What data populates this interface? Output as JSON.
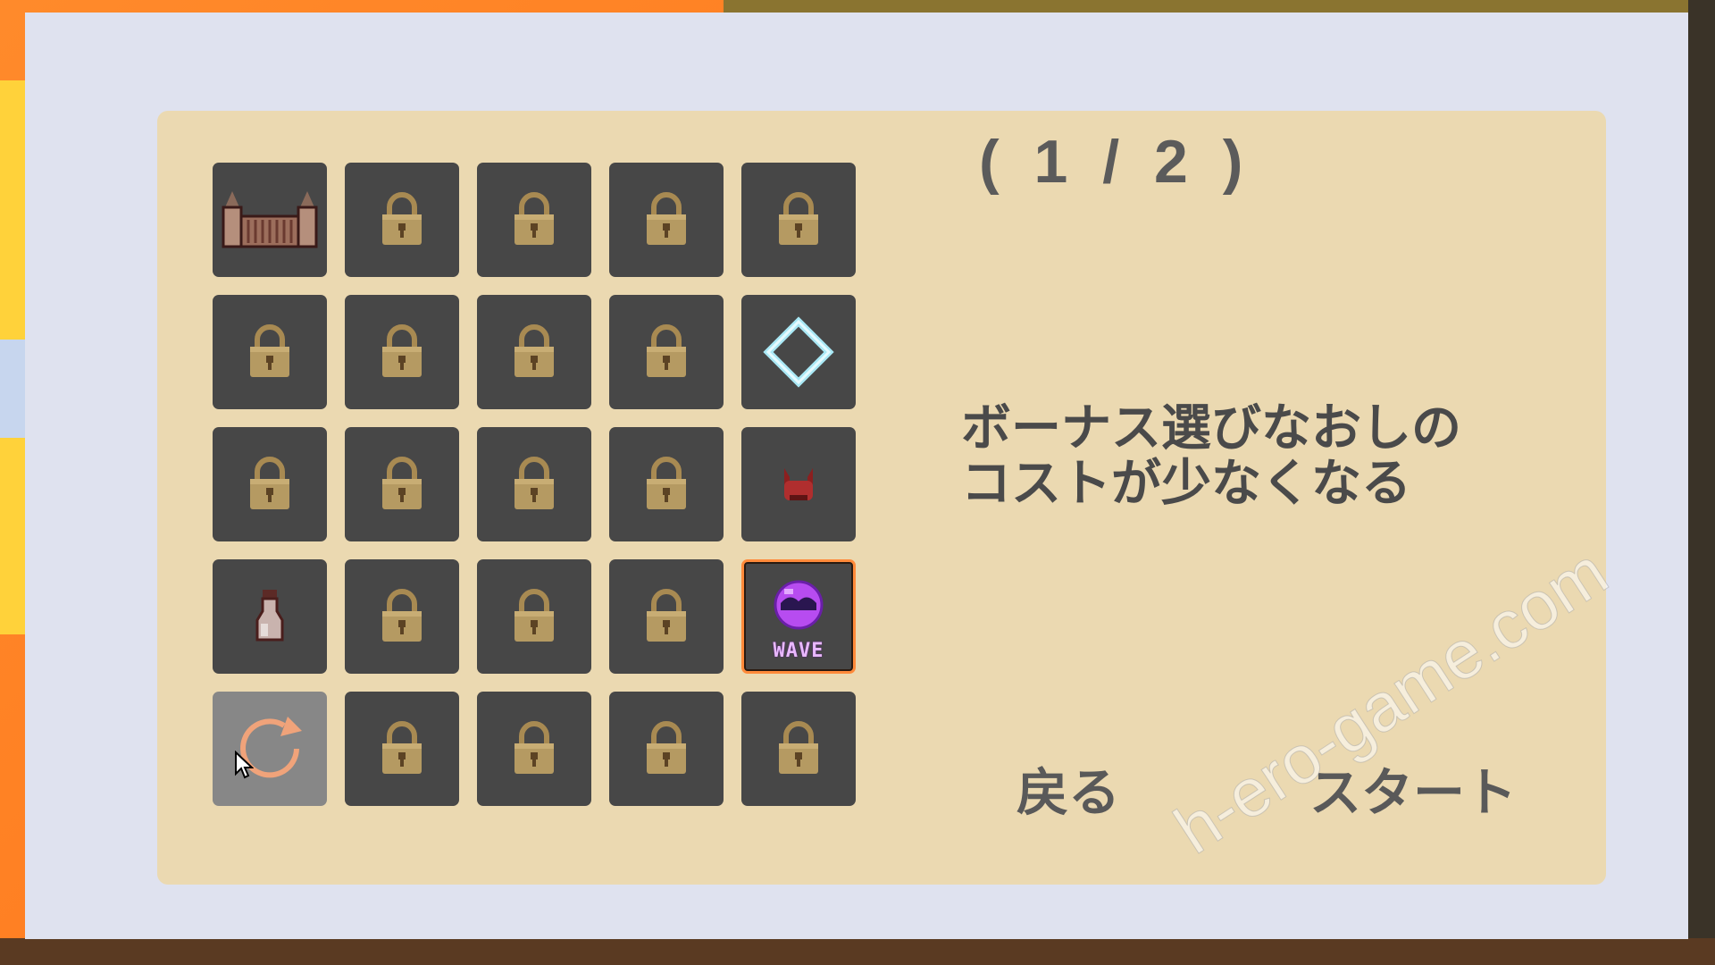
{
  "page_indicator": "( 1 / 2 )",
  "description": "ボーナス選びなおしの\nコストが少なくなる",
  "buttons": {
    "back": "戻る",
    "start": "スタート"
  },
  "slot_rows": [
    [
      {
        "icon": "gate-icon",
        "state": "unlocked"
      },
      {
        "icon": "padlock-icon",
        "state": "locked"
      },
      {
        "icon": "padlock-icon",
        "state": "locked"
      },
      {
        "icon": "padlock-icon",
        "state": "locked"
      },
      {
        "icon": "padlock-icon",
        "state": "locked"
      }
    ],
    [
      {
        "icon": "padlock-icon",
        "state": "locked"
      },
      {
        "icon": "padlock-icon",
        "state": "locked"
      },
      {
        "icon": "padlock-icon",
        "state": "locked"
      },
      {
        "icon": "padlock-icon",
        "state": "locked"
      },
      {
        "icon": "diamond-icon",
        "state": "unlocked"
      }
    ],
    [
      {
        "icon": "padlock-icon",
        "state": "locked"
      },
      {
        "icon": "padlock-icon",
        "state": "locked"
      },
      {
        "icon": "padlock-icon",
        "state": "locked"
      },
      {
        "icon": "padlock-icon",
        "state": "locked"
      },
      {
        "icon": "horned-helmet-icon",
        "state": "unlocked"
      }
    ],
    [
      {
        "icon": "bottle-icon",
        "state": "unlocked"
      },
      {
        "icon": "padlock-icon",
        "state": "locked"
      },
      {
        "icon": "padlock-icon",
        "state": "locked"
      },
      {
        "icon": "padlock-icon",
        "state": "locked"
      },
      {
        "icon": "wave-orb-icon",
        "state": "selected",
        "label": "WAVE"
      }
    ],
    [
      {
        "icon": "reroll-arrow-icon",
        "state": "hovered"
      },
      {
        "icon": "padlock-icon",
        "state": "locked"
      },
      {
        "icon": "padlock-icon",
        "state": "locked"
      },
      {
        "icon": "padlock-icon",
        "state": "locked"
      },
      {
        "icon": "padlock-icon",
        "state": "locked"
      }
    ]
  ],
  "watermark": "h-ero-game.com",
  "colors": {
    "panel": "#ebd9b1",
    "frame": "#dfe2ef",
    "slot": "#474747",
    "slot_hover": "#878787",
    "selected_border": "#ff8a3a",
    "lock": "#b59a62",
    "text": "#4a4a4a"
  }
}
